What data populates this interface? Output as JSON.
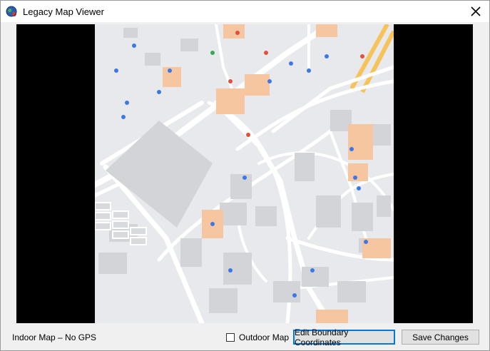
{
  "window": {
    "title": "Legacy Map Viewer"
  },
  "icons": {
    "app": "globe-icon",
    "close": "close-icon"
  },
  "footer": {
    "status_text": "Indoor Map – No GPS",
    "outdoor_checkbox_label": "Outdoor Map",
    "outdoor_checked": false,
    "edit_button_label": "Edit Boundary Coordinates",
    "save_button_label": "Save Changes"
  },
  "map": {
    "colors": {
      "background": "#e8e9ec",
      "road": "#ffffff",
      "building": "#d3d4d8",
      "highlight_building": "#f5c6a0",
      "highway": "#f6c25a",
      "pin_blue": "#3b78e7",
      "pin_red": "#e0503b"
    }
  }
}
